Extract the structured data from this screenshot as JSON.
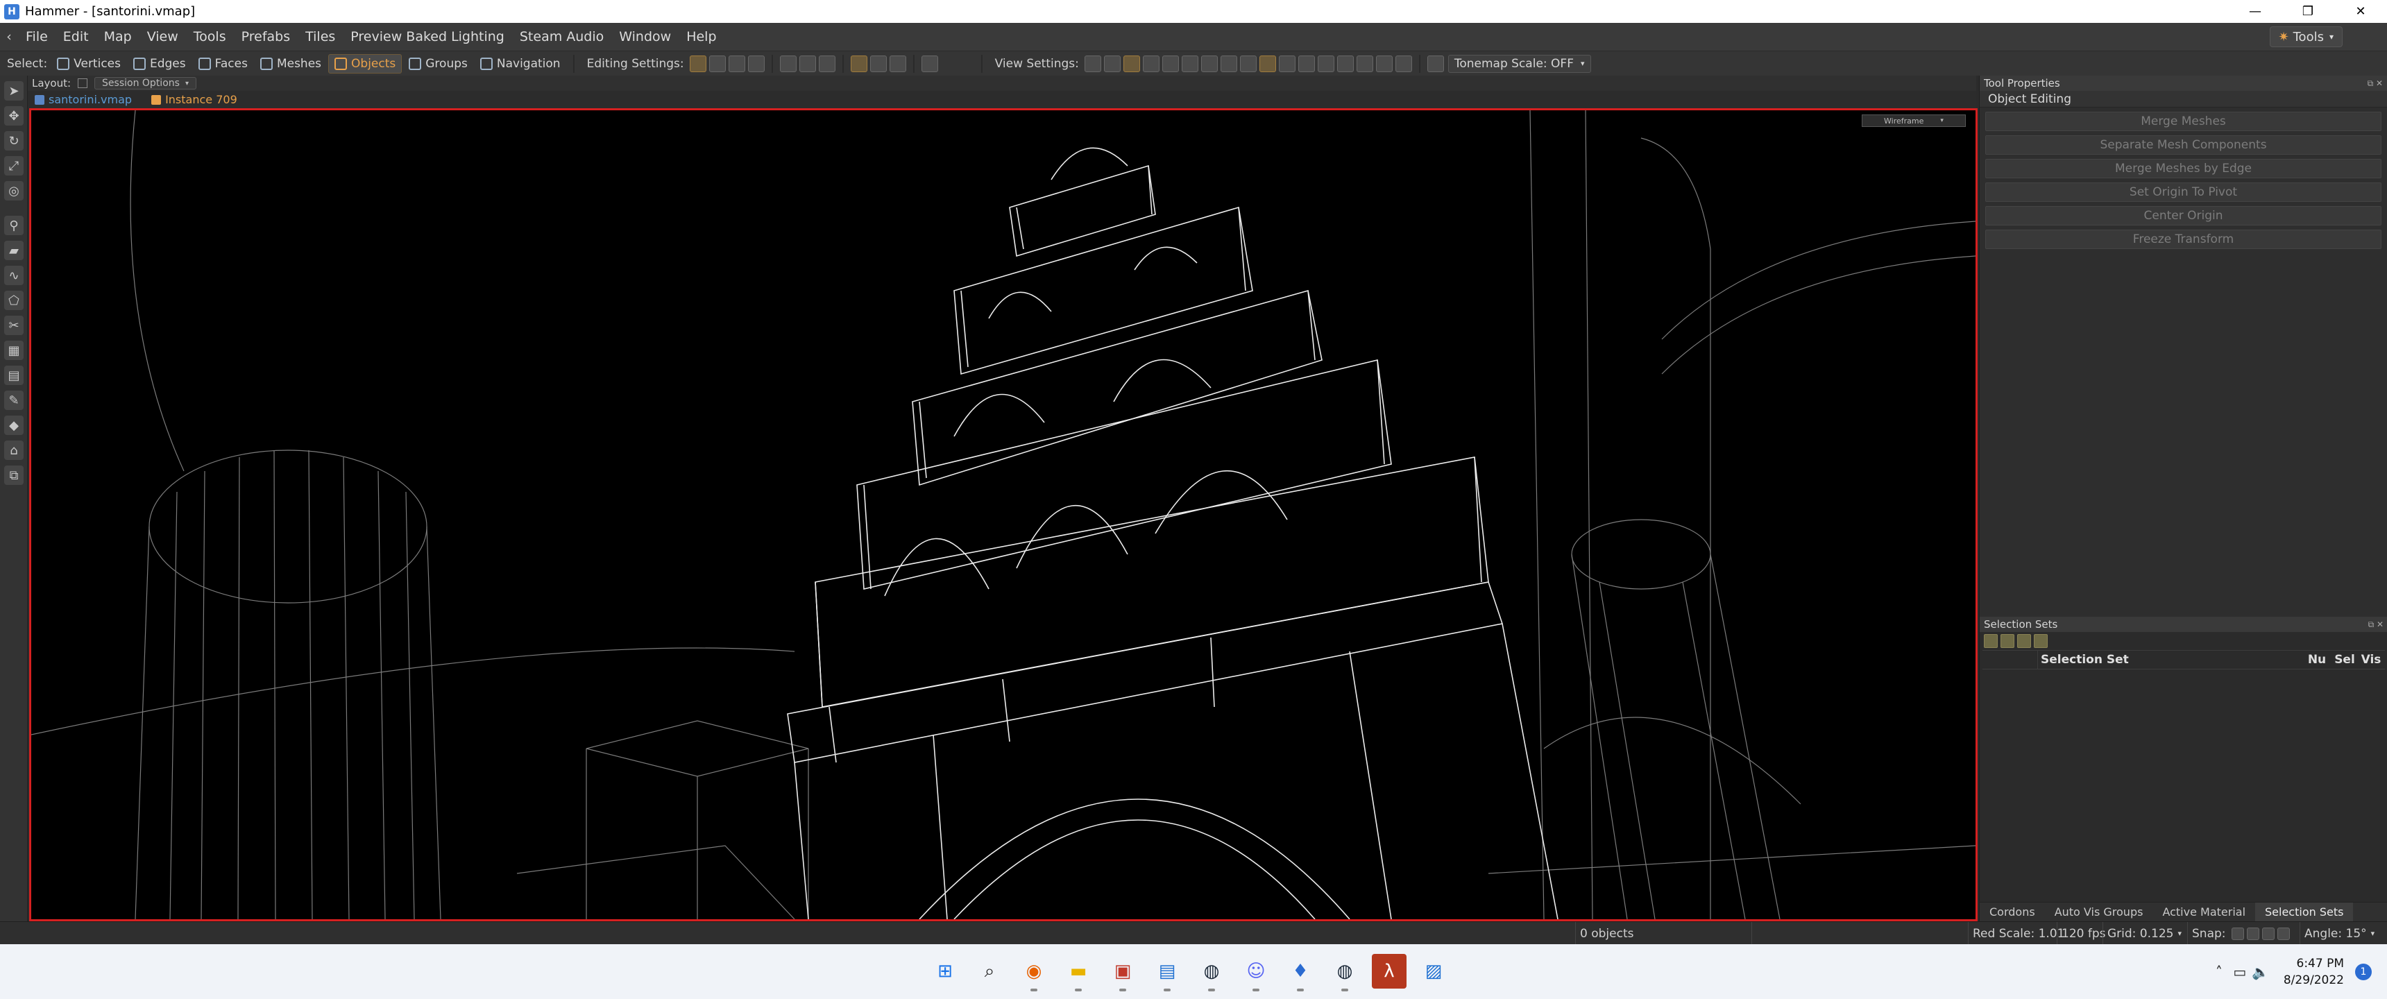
{
  "window": {
    "title": "Hammer - [santorini.vmap]",
    "min": "—",
    "restore": "❐",
    "close": "✕"
  },
  "menu": {
    "items": [
      "File",
      "Edit",
      "Map",
      "View",
      "Tools",
      "Prefabs",
      "Tiles",
      "Preview Baked Lighting",
      "Steam Audio",
      "Window",
      "Help"
    ],
    "tools_button": "Tools"
  },
  "toolbar": {
    "select_label": "Select:",
    "select_modes": [
      "Vertices",
      "Edges",
      "Faces",
      "Meshes",
      "Objects",
      "Groups",
      "Navigation"
    ],
    "active_mode": "Objects",
    "editing_settings_label": "Editing Settings:",
    "view_settings_label": "View Settings:",
    "tonemap": "Tonemap Scale: OFF"
  },
  "layout": {
    "label": "Layout:",
    "session_options": "Session Options"
  },
  "breadcrumb": {
    "file": "santorini.vmap",
    "instance": "Instance 709"
  },
  "viewport": {
    "mode": "Wireframe"
  },
  "tool_properties": {
    "title": "Tool Properties",
    "section": "Object Editing",
    "buttons": [
      "Merge Meshes",
      "Separate Mesh Components",
      "Merge Meshes by Edge",
      "Set Origin To Pivot",
      "Center Origin",
      "Freeze Transform"
    ]
  },
  "selection_sets": {
    "title": "Selection Sets",
    "columns": {
      "name": "Selection Set",
      "num": "Nu",
      "sel": "Sel",
      "vis": "Vis"
    }
  },
  "panel_tabs": [
    "Cordons",
    "Auto Vis Groups",
    "Active Material",
    "Selection Sets"
  ],
  "active_panel_tab": "Selection Sets",
  "status": {
    "objects": "0 objects",
    "red_scale": "Red Scale: 1.01",
    "fps": "120 fps",
    "grid": "Grid: 0.125",
    "snap": "Snap:",
    "angle": "Angle: 15°"
  },
  "taskbar": {
    "icons": [
      "windows-start",
      "search",
      "firefox",
      "file-explorer",
      "app-red",
      "notes",
      "steam",
      "discord",
      "app-white",
      "steam-2",
      "hammer",
      "photos"
    ],
    "time": "6:47 PM",
    "date": "8/29/2022",
    "notifications": "1"
  },
  "colors": {
    "viewport_border": "#d62020",
    "accent": "#e8a14a",
    "link": "#5b9bd5"
  }
}
